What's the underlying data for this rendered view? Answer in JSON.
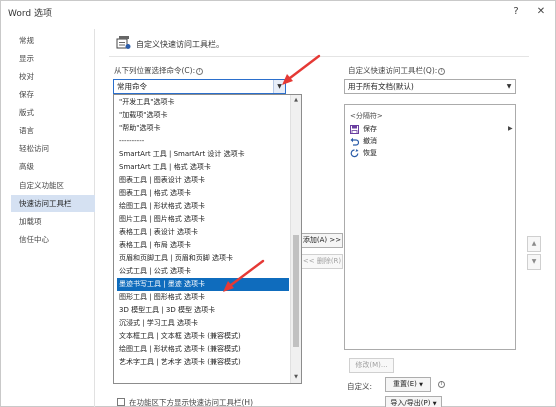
{
  "window": {
    "title": "Word 选项",
    "help_label": "?",
    "close_label": "✕"
  },
  "nav": {
    "items": [
      {
        "label": "常规"
      },
      {
        "label": "显示"
      },
      {
        "label": "校对"
      },
      {
        "label": "保存"
      },
      {
        "label": "版式"
      },
      {
        "label": "语言"
      },
      {
        "label": "轻松访问"
      },
      {
        "label": "高级"
      },
      {
        "label": "自定义功能区"
      },
      {
        "label": "快速访问工具栏",
        "active": true
      },
      {
        "label": "加载项"
      },
      {
        "label": "信任中心"
      }
    ]
  },
  "section": {
    "title": "自定义快速访问工具栏。"
  },
  "choose_from": {
    "label": "从下列位置选择命令(C):",
    "info": "ⓘ",
    "value": "常用命令",
    "arrow": "▼"
  },
  "customize_toolbar": {
    "label": "自定义快速访问工具栏(Q):",
    "info": "ⓘ",
    "value": "用于所有文档(默认)",
    "arrow": "▼"
  },
  "dropdown": {
    "items": [
      "\"开发工具\"选项卡",
      "\"加载项\"选项卡",
      "\"帮助\"选项卡",
      "----------",
      "SmartArt 工具 | SmartArt 设计 选项卡",
      "SmartArt 工具 | 格式 选项卡",
      "图表工具 | 图表设计 选项卡",
      "图表工具 | 格式 选项卡",
      "绘图工具 | 形状格式 选项卡",
      "图片工具 | 图片格式 选项卡",
      "表格工具 | 表设计 选项卡",
      "表格工具 | 布局 选项卡",
      "页眉和页脚工具 | 页眉和页脚 选项卡",
      "公式工具 | 公式 选项卡",
      "墨迹书写工具 | 墨迹 选项卡",
      "图形工具 | 图形格式 选项卡",
      "3D 模型工具 | 3D 模型 选项卡",
      "沉浸式 | 学习工具 选项卡",
      "文本框工具 | 文本框 选项卡 (兼容模式)",
      "绘图工具 | 形状格式 选项卡 (兼容模式)",
      "艺术字工具 | 艺术字 选项卡 (兼容模式)"
    ],
    "selected_index": 14,
    "scroll_up": "▲",
    "scroll_down": "▼"
  },
  "buttons": {
    "add": "添加(A) >>",
    "remove": "<< 删除(R)",
    "modify": "修改(M)...",
    "reset": "重置(E)",
    "reset_arrow": "▼",
    "import_export": "导入/导出(P)",
    "import_export_arrow": "▼"
  },
  "right_list": {
    "separator": "<分隔符>",
    "items": [
      {
        "label": "保存",
        "icon": "save-icon",
        "color": "#6a3fa0"
      },
      {
        "label": "撤消",
        "icon": "undo-icon",
        "color": "#2b5ca8"
      },
      {
        "label": "恢复",
        "icon": "redo-icon",
        "color": "#2b5ca8"
      }
    ],
    "expand_arrow": "▶"
  },
  "updown": {
    "up": "▲",
    "down": "▼"
  },
  "customize_label": "自定义:",
  "below_ribbon_checkbox": {
    "label": "在功能区下方显示快速访问工具栏(H)",
    "checked": false
  },
  "colors": {
    "accent": "#0f6cbd",
    "nav_active": "#d5e1f2",
    "annotation_red": "#e53935"
  }
}
